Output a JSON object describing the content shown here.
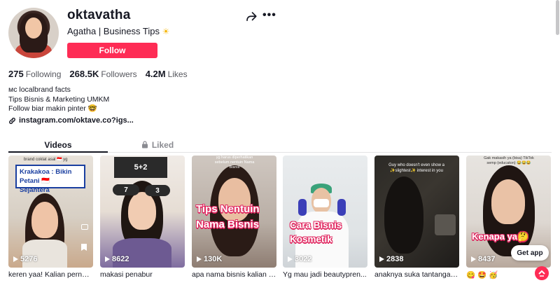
{
  "profile": {
    "username": "oktavatha",
    "nickname": "Agatha | Business Tips",
    "nickname_emoji": "☀",
    "follow_label": "Follow"
  },
  "stats": {
    "following_count": "275",
    "following_label": "Following",
    "followers_count": "268.5K",
    "followers_label": "Followers",
    "likes_count": "4.2M",
    "likes_label": "Likes"
  },
  "bio": {
    "line1": "ᴍᴄ localbrand facts",
    "line2": "Tips Bisnis & Marketing UMKM",
    "line3": "Follow biar makin pinter 🤓"
  },
  "link": "instagram.com/oktave.co?igs...",
  "tabs": {
    "videos": "Videos",
    "liked": "Liked"
  },
  "videos": [
    {
      "views": "5276",
      "caption": "keren yaa! Kalian pernah...",
      "overlay_top": "brand coklat asal 🇮🇩 yg",
      "overlay_box": "Krakakoa : Bikin Petani 🇮🇩 Sejahtera"
    },
    {
      "views": "8622",
      "caption": "makasi penabur",
      "overlay_eq": "5+2",
      "overlay_a": "7",
      "overlay_b": "3"
    },
    {
      "views": "130K",
      "caption": "apa nama bisnis kalian &...",
      "overlay_top": "yg harus diperhatikan sebelum nentuin Nama Bisnis",
      "overlay_main": "Tips Nentuin Nama Bisnis"
    },
    {
      "views": "3022",
      "caption": "Yg mau jadi beautypren...",
      "overlay_main": "Cara Bisnis Kosmetik"
    },
    {
      "views": "2838",
      "caption": "anaknya suka tantangan ...",
      "overlay_top": "Guy who doesn't even show a ✨slightest✨ interest in you"
    },
    {
      "views": "8437",
      "caption": "😋 🤩 🥳",
      "overlay_top": "Gak makasih ya (bisa) TikTok semp (educaton) 😂😂😂",
      "overlay_main": "Kenapa ya🤔"
    }
  ],
  "get_app": "Get app",
  "colors": {
    "accent": "#fe2c55",
    "text": "#161823",
    "muted": "#8a8b91"
  }
}
